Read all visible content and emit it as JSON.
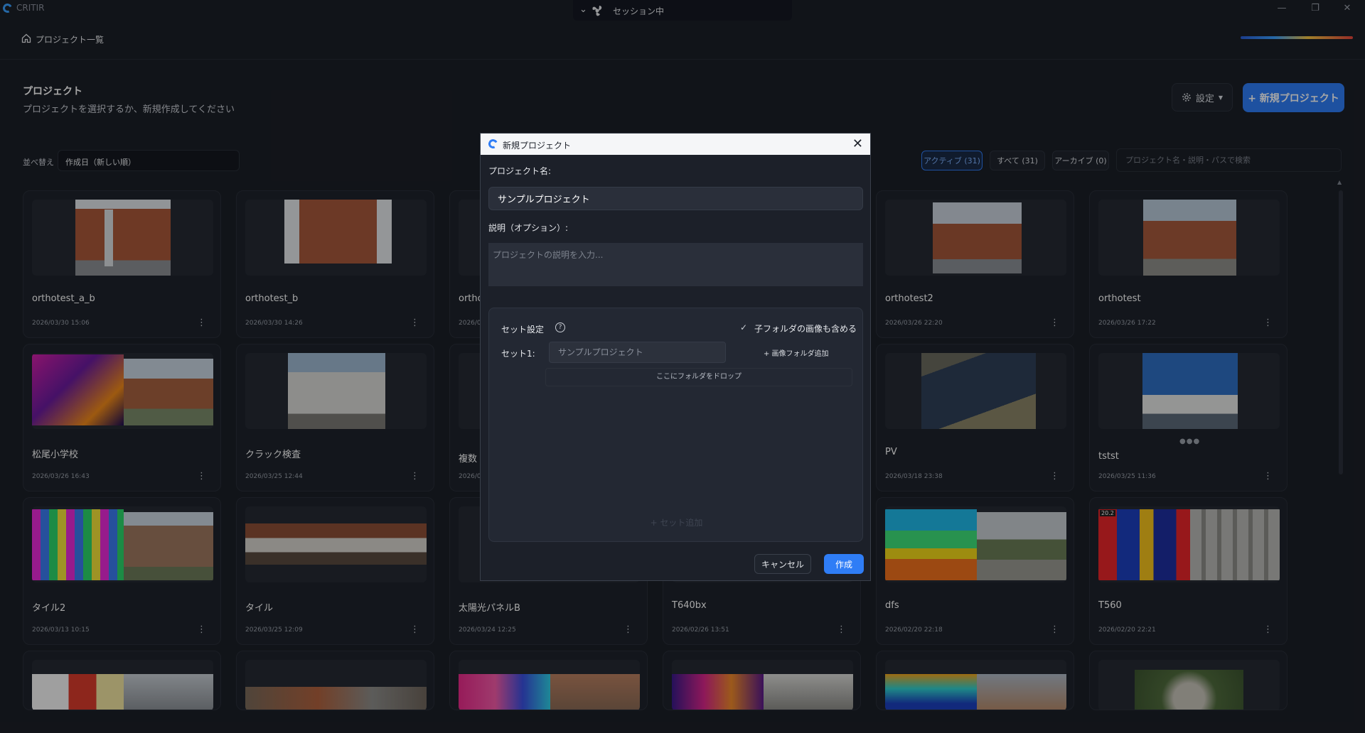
{
  "app": {
    "name": "CRITIR",
    "session_label": "セッション中"
  },
  "nav": {
    "home_label": "プロジェクト一覧"
  },
  "header": {
    "title": "プロジェクト",
    "subtitle": "プロジェクトを選択するか、新規作成してください",
    "settings_label": "設定",
    "new_project_label": "+ 新規プロジェクト"
  },
  "filters": {
    "sort_label": "並べ替え",
    "sort_value": "作成日（新しい順）",
    "tabs": [
      {
        "label": "アクティブ (31)",
        "active": true
      },
      {
        "label": "すべて (31)",
        "active": false
      },
      {
        "label": "アーカイブ (0)",
        "active": false
      }
    ],
    "search_placeholder": "プロジェクト名・説明・パスで検索"
  },
  "projects": [
    {
      "name": "orthotest_a_b",
      "date": "2026/03/30 15:06"
    },
    {
      "name": "orthotest_b",
      "date": "2026/03/30 14:26"
    },
    {
      "name": "ortho",
      "date": "2026/0"
    },
    {
      "name": "",
      "date": ""
    },
    {
      "name": "orthotest2",
      "date": "2026/03/26 22:20"
    },
    {
      "name": "orthotest",
      "date": "2026/03/26 17:22"
    },
    {
      "name": "松尾小学校",
      "date": "2026/03/26 16:43"
    },
    {
      "name": "クラック検査",
      "date": "2026/03/25 12:44"
    },
    {
      "name": "複数",
      "date": "2026/0"
    },
    {
      "name": "",
      "date": ""
    },
    {
      "name": "PV",
      "date": "2026/03/18 23:38"
    },
    {
      "name": "tstst",
      "date": "2026/03/25 11:36"
    },
    {
      "name": "タイル2",
      "date": "2026/03/13 10:15"
    },
    {
      "name": "タイル",
      "date": "2026/03/25 12:09"
    },
    {
      "name": "太陽光パネルB",
      "date": "2026/03/24 12:25"
    },
    {
      "name": "T640bx",
      "date": "2026/02/26 13:51"
    },
    {
      "name": "dfs",
      "date": "2026/02/20 22:18"
    },
    {
      "name": "T560",
      "date": "2026/02/20 22:21"
    }
  ],
  "thumb_overlay": {
    "t560_temp": "20.2"
  },
  "dialog": {
    "title": "新規プロジェクト",
    "name_label": "プロジェクト名:",
    "name_value": "サンプルプロジェクト",
    "desc_label": "説明（オプション）:",
    "desc_placeholder": "プロジェクトの説明を入力...",
    "set_settings_label": "セット設定",
    "include_subfolders_label": "子フォルダの画像も含める",
    "include_subfolders_checked": true,
    "set1_label": "セット1:",
    "set1_placeholder": "サンプルプロジェクト",
    "add_folder_label": "+ 画像フォルダ追加",
    "drop_label": "ここにフォルダをドロップ",
    "add_set_label": "+ セット追加",
    "cancel_label": "キャンセル",
    "create_label": "作成"
  }
}
